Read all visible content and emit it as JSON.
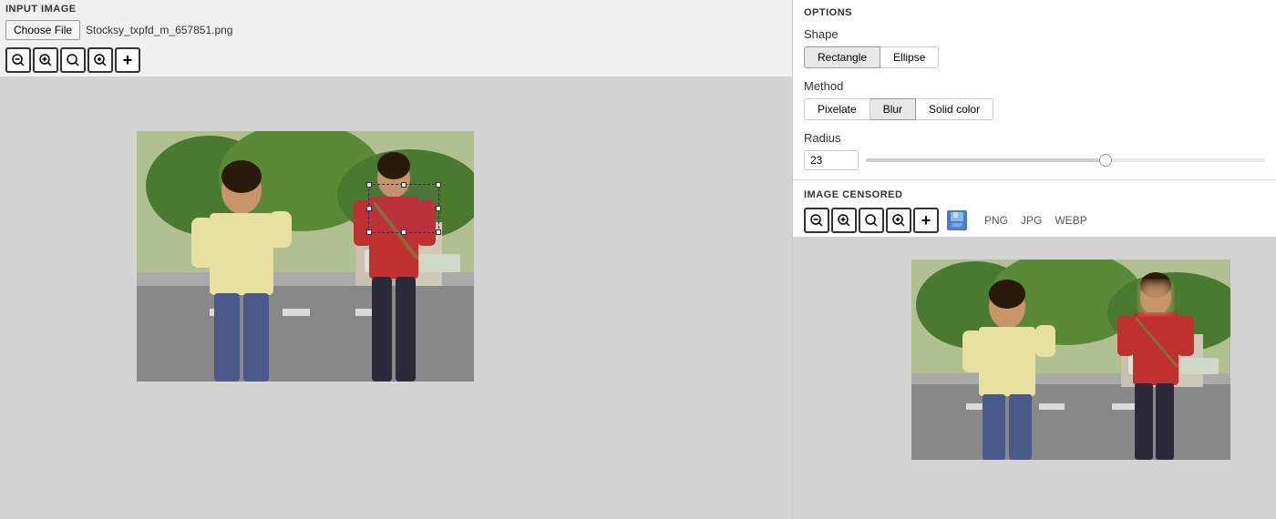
{
  "header": {
    "input_label": "INPUT IMAGE",
    "choose_file_label": "Choose File",
    "file_name": "Stocksy_txpfd_m_657851.png"
  },
  "zoom_buttons": [
    {
      "icon": "🔍",
      "label": "zoom-out",
      "symbol": "−"
    },
    {
      "icon": "🔍",
      "label": "zoom-in",
      "symbol": "+"
    },
    {
      "icon": "🔍",
      "label": "zoom-fit"
    },
    {
      "icon": "🔍",
      "label": "zoom-100"
    },
    {
      "icon": "+",
      "label": "add"
    }
  ],
  "options": {
    "header": "OPTIONS",
    "shape": {
      "label": "Shape",
      "options": [
        "Rectangle",
        "Ellipse"
      ],
      "active": "Rectangle"
    },
    "method": {
      "label": "Method",
      "options": [
        "Pixelate",
        "Blur",
        "Solid color"
      ],
      "active": "Blur"
    },
    "radius": {
      "label": "Radius",
      "value": "23",
      "slider_percent": 60
    }
  },
  "image_censored": {
    "header": "IMAGE CENSORED",
    "formats": [
      "PNG",
      "JPG",
      "WEBP"
    ]
  }
}
